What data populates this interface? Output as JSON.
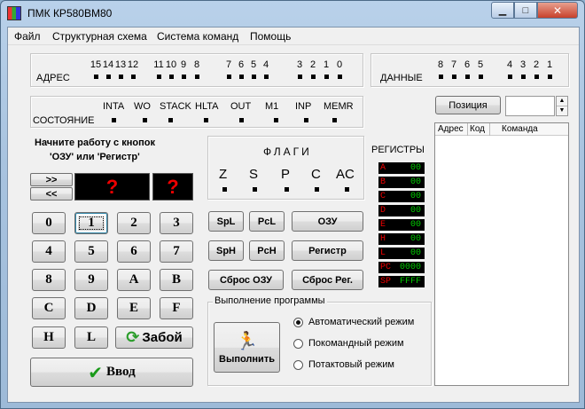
{
  "window": {
    "title": "ПМК КР580ВМ80",
    "minimize_glyph": "▁",
    "maximize_glyph": "□",
    "close_glyph": "✕"
  },
  "menu": [
    "Файл",
    "Структурная схема",
    "Система команд",
    "Помощь"
  ],
  "address": {
    "label": "АДРЕС",
    "bits": [
      "15",
      "14",
      "13",
      "12",
      "11",
      "10",
      "9",
      "8",
      "7",
      "6",
      "5",
      "4",
      "3",
      "2",
      "1",
      "0"
    ]
  },
  "data_panel": {
    "label": "ДАННЫЕ",
    "bits": [
      "8",
      "7",
      "6",
      "5",
      "4",
      "3",
      "2",
      "1"
    ]
  },
  "state": {
    "label": "СОСТОЯНИЕ",
    "signals": [
      "INTA",
      "WO",
      "STACK",
      "HLTA",
      "OUT",
      "M1",
      "INP",
      "MEMR"
    ]
  },
  "hint": {
    "line1": "Начните работу с кнопок",
    "line2": "'ОЗУ' или 'Регистр'"
  },
  "nav": {
    "forward": ">>",
    "back": "<<"
  },
  "display": {
    "left": "?",
    "right": "?"
  },
  "keypad": [
    "0",
    "1",
    "2",
    "3",
    "4",
    "5",
    "6",
    "7",
    "8",
    "9",
    "A",
    "B",
    "C",
    "D",
    "E",
    "F",
    "H",
    "L"
  ],
  "zaboy_label": "Забой",
  "enter_label": "Ввод",
  "flags": {
    "title": "ФЛАГИ",
    "items": [
      "Z",
      "S",
      "P",
      "C",
      "AC"
    ]
  },
  "ops": {
    "spl": "SpL",
    "pcl": "PcL",
    "ozu": "ОЗУ",
    "sph": "SpH",
    "pch": "PcH",
    "register": "Регистр",
    "reset_ozu": "Сброс ОЗУ",
    "reset_reg": "Сброс Рег."
  },
  "registers": {
    "title": "РЕГИСТРЫ",
    "items": [
      {
        "name": "A",
        "value": "00"
      },
      {
        "name": "B",
        "value": "00"
      },
      {
        "name": "C",
        "value": "00"
      },
      {
        "name": "D",
        "value": "00"
      },
      {
        "name": "E",
        "value": "00"
      },
      {
        "name": "H",
        "value": "00"
      },
      {
        "name": "L",
        "value": "00"
      },
      {
        "name": "PC",
        "value": "0000"
      },
      {
        "name": "SP",
        "value": "FFFF"
      }
    ]
  },
  "program": {
    "title": "Выполнение программы",
    "run_label": "Выполнить",
    "modes": [
      "Автоматический режим",
      "Покомандный режим",
      "Потактовый режим"
    ],
    "selected_mode": 0
  },
  "position": {
    "button": "Позиция",
    "value": ""
  },
  "listing": {
    "columns": [
      "Адрес",
      "Код",
      "Команда"
    ]
  },
  "colors": {
    "led": "#000000",
    "display_text": "#e00000",
    "register_value": "#00cc00",
    "register_name": "#e00000"
  }
}
